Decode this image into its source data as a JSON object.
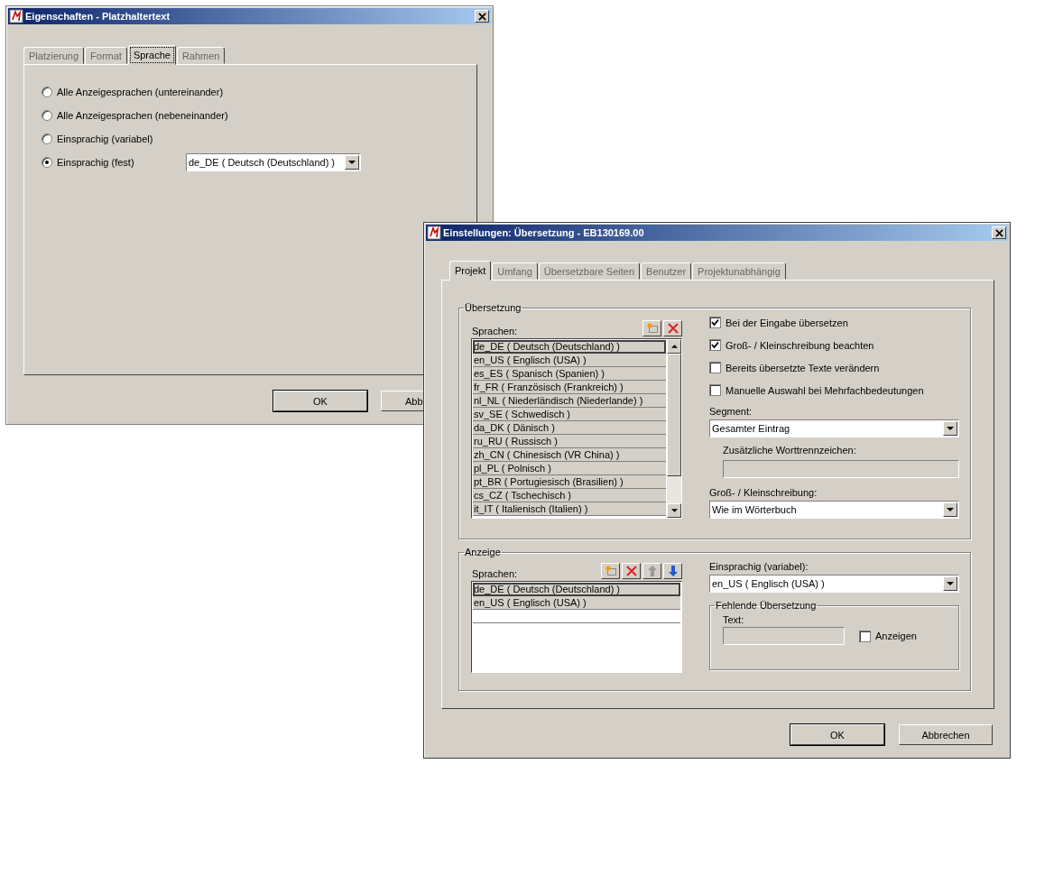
{
  "properties_dialog": {
    "title": "Eigenschaften - Platzhaltertext",
    "tabs": [
      {
        "label": "Platzierung",
        "selected": false
      },
      {
        "label": "Format",
        "selected": false
      },
      {
        "label": "Sprache",
        "selected": true
      },
      {
        "label": "Rahmen",
        "selected": false
      }
    ],
    "options": [
      {
        "label": "Alle Anzeigesprachen (untereinander)",
        "selected": false
      },
      {
        "label": "Alle Anzeigesprachen (nebeneinander)",
        "selected": false
      },
      {
        "label": "Einsprachig (variabel)",
        "selected": false
      },
      {
        "label": "Einsprachig (fest)",
        "selected": true
      }
    ],
    "language_select": "de_DE ( Deutsch (Deutschland) )",
    "buttons": [
      "OK",
      "Abb"
    ]
  },
  "translation_dialog": {
    "title": "Einstellungen: Übersetzung - EB130169.00",
    "tabs": [
      {
        "label": "Projekt",
        "selected": true
      },
      {
        "label": "Umfang",
        "selected": false
      },
      {
        "label": "Übersetzbare Seiten",
        "selected": false
      },
      {
        "label": "Benutzer",
        "selected": false
      },
      {
        "label": "Projektunabhängig",
        "selected": false
      }
    ],
    "translation_group": {
      "title": "Übersetzung",
      "languages_label": "Sprachen:",
      "languages": [
        {
          "label": "de_DE ( Deutsch (Deutschland) )",
          "selected": true
        },
        {
          "label": "en_US ( Englisch (USA) )",
          "selected": false
        },
        {
          "label": "es_ES ( Spanisch (Spanien) )",
          "selected": false
        },
        {
          "label": "fr_FR ( Französisch (Frankreich) )",
          "selected": false
        },
        {
          "label": "nl_NL ( Niederländisch (Niederlande) )",
          "selected": false
        },
        {
          "label": "sv_SE ( Schwedisch )",
          "selected": false
        },
        {
          "label": "da_DK ( Dänisch )",
          "selected": false
        },
        {
          "label": "ru_RU ( Russisch )",
          "selected": false
        },
        {
          "label": "zh_CN ( Chinesisch (VR China) )",
          "selected": false
        },
        {
          "label": "pl_PL ( Polnisch )",
          "selected": false
        },
        {
          "label": "pt_BR ( Portugiesisch (Brasilien) )",
          "selected": false
        },
        {
          "label": "cs_CZ ( Tschechisch )",
          "selected": false
        },
        {
          "label": "it_IT ( Italienisch (Italien) )",
          "selected": false
        }
      ],
      "options": [
        {
          "label": "Bei der Eingabe übersetzen",
          "checked": true
        },
        {
          "label": "Groß- / Kleinschreibung beachten",
          "checked": true
        },
        {
          "label": "Bereits übersetzte Texte verändern",
          "checked": false
        },
        {
          "label": "Manuelle Auswahl bei Mehrfachbedeutungen",
          "checked": false
        }
      ],
      "segment_label": "Segment:",
      "segment_value": "Gesamter Eintrag",
      "separators_label": "Zusätzliche Worttrennzeichen:",
      "case_label": "Groß- / Kleinschreibung:",
      "case_value": "Wie im Wörterbuch"
    },
    "display_group": {
      "title": "Anzeige",
      "languages_label": "Sprachen:",
      "languages": [
        {
          "label": "de_DE ( Deutsch (Deutschland) )",
          "selected": true
        },
        {
          "label": "en_US ( Englisch (USA) )",
          "selected": false
        }
      ],
      "monolingual_label": "Einsprachig (variabel):",
      "monolingual_value": "en_US ( Englisch (USA) )",
      "missing_group": {
        "title": "Fehlende Übersetzung",
        "text_label": "Text:",
        "show": {
          "label": "Anzeigen",
          "checked": false
        }
      }
    },
    "buttons": [
      "OK",
      "Abbrechen"
    ]
  }
}
